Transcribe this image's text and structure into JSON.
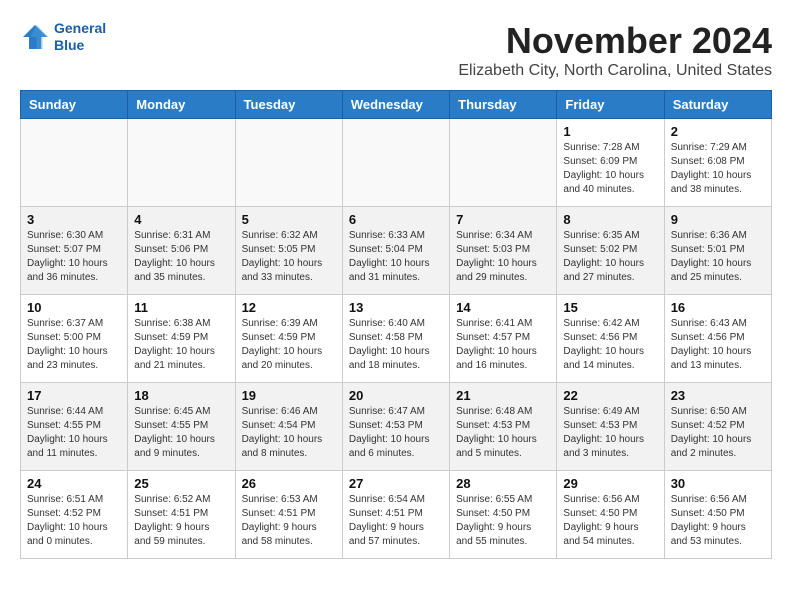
{
  "logo": {
    "line1": "General",
    "line2": "Blue"
  },
  "title": "November 2024",
  "subtitle": "Elizabeth City, North Carolina, United States",
  "days_of_week": [
    "Sunday",
    "Monday",
    "Tuesday",
    "Wednesday",
    "Thursday",
    "Friday",
    "Saturday"
  ],
  "weeks": [
    [
      {
        "day": "",
        "info": ""
      },
      {
        "day": "",
        "info": ""
      },
      {
        "day": "",
        "info": ""
      },
      {
        "day": "",
        "info": ""
      },
      {
        "day": "",
        "info": ""
      },
      {
        "day": "1",
        "info": "Sunrise: 7:28 AM\nSunset: 6:09 PM\nDaylight: 10 hours\nand 40 minutes."
      },
      {
        "day": "2",
        "info": "Sunrise: 7:29 AM\nSunset: 6:08 PM\nDaylight: 10 hours\nand 38 minutes."
      }
    ],
    [
      {
        "day": "3",
        "info": "Sunrise: 6:30 AM\nSunset: 5:07 PM\nDaylight: 10 hours\nand 36 minutes."
      },
      {
        "day": "4",
        "info": "Sunrise: 6:31 AM\nSunset: 5:06 PM\nDaylight: 10 hours\nand 35 minutes."
      },
      {
        "day": "5",
        "info": "Sunrise: 6:32 AM\nSunset: 5:05 PM\nDaylight: 10 hours\nand 33 minutes."
      },
      {
        "day": "6",
        "info": "Sunrise: 6:33 AM\nSunset: 5:04 PM\nDaylight: 10 hours\nand 31 minutes."
      },
      {
        "day": "7",
        "info": "Sunrise: 6:34 AM\nSunset: 5:03 PM\nDaylight: 10 hours\nand 29 minutes."
      },
      {
        "day": "8",
        "info": "Sunrise: 6:35 AM\nSunset: 5:02 PM\nDaylight: 10 hours\nand 27 minutes."
      },
      {
        "day": "9",
        "info": "Sunrise: 6:36 AM\nSunset: 5:01 PM\nDaylight: 10 hours\nand 25 minutes."
      }
    ],
    [
      {
        "day": "10",
        "info": "Sunrise: 6:37 AM\nSunset: 5:00 PM\nDaylight: 10 hours\nand 23 minutes."
      },
      {
        "day": "11",
        "info": "Sunrise: 6:38 AM\nSunset: 4:59 PM\nDaylight: 10 hours\nand 21 minutes."
      },
      {
        "day": "12",
        "info": "Sunrise: 6:39 AM\nSunset: 4:59 PM\nDaylight: 10 hours\nand 20 minutes."
      },
      {
        "day": "13",
        "info": "Sunrise: 6:40 AM\nSunset: 4:58 PM\nDaylight: 10 hours\nand 18 minutes."
      },
      {
        "day": "14",
        "info": "Sunrise: 6:41 AM\nSunset: 4:57 PM\nDaylight: 10 hours\nand 16 minutes."
      },
      {
        "day": "15",
        "info": "Sunrise: 6:42 AM\nSunset: 4:56 PM\nDaylight: 10 hours\nand 14 minutes."
      },
      {
        "day": "16",
        "info": "Sunrise: 6:43 AM\nSunset: 4:56 PM\nDaylight: 10 hours\nand 13 minutes."
      }
    ],
    [
      {
        "day": "17",
        "info": "Sunrise: 6:44 AM\nSunset: 4:55 PM\nDaylight: 10 hours\nand 11 minutes."
      },
      {
        "day": "18",
        "info": "Sunrise: 6:45 AM\nSunset: 4:55 PM\nDaylight: 10 hours\nand 9 minutes."
      },
      {
        "day": "19",
        "info": "Sunrise: 6:46 AM\nSunset: 4:54 PM\nDaylight: 10 hours\nand 8 minutes."
      },
      {
        "day": "20",
        "info": "Sunrise: 6:47 AM\nSunset: 4:53 PM\nDaylight: 10 hours\nand 6 minutes."
      },
      {
        "day": "21",
        "info": "Sunrise: 6:48 AM\nSunset: 4:53 PM\nDaylight: 10 hours\nand 5 minutes."
      },
      {
        "day": "22",
        "info": "Sunrise: 6:49 AM\nSunset: 4:53 PM\nDaylight: 10 hours\nand 3 minutes."
      },
      {
        "day": "23",
        "info": "Sunrise: 6:50 AM\nSunset: 4:52 PM\nDaylight: 10 hours\nand 2 minutes."
      }
    ],
    [
      {
        "day": "24",
        "info": "Sunrise: 6:51 AM\nSunset: 4:52 PM\nDaylight: 10 hours\nand 0 minutes."
      },
      {
        "day": "25",
        "info": "Sunrise: 6:52 AM\nSunset: 4:51 PM\nDaylight: 9 hours\nand 59 minutes."
      },
      {
        "day": "26",
        "info": "Sunrise: 6:53 AM\nSunset: 4:51 PM\nDaylight: 9 hours\nand 58 minutes."
      },
      {
        "day": "27",
        "info": "Sunrise: 6:54 AM\nSunset: 4:51 PM\nDaylight: 9 hours\nand 57 minutes."
      },
      {
        "day": "28",
        "info": "Sunrise: 6:55 AM\nSunset: 4:50 PM\nDaylight: 9 hours\nand 55 minutes."
      },
      {
        "day": "29",
        "info": "Sunrise: 6:56 AM\nSunset: 4:50 PM\nDaylight: 9 hours\nand 54 minutes."
      },
      {
        "day": "30",
        "info": "Sunrise: 6:56 AM\nSunset: 4:50 PM\nDaylight: 9 hours\nand 53 minutes."
      }
    ]
  ]
}
